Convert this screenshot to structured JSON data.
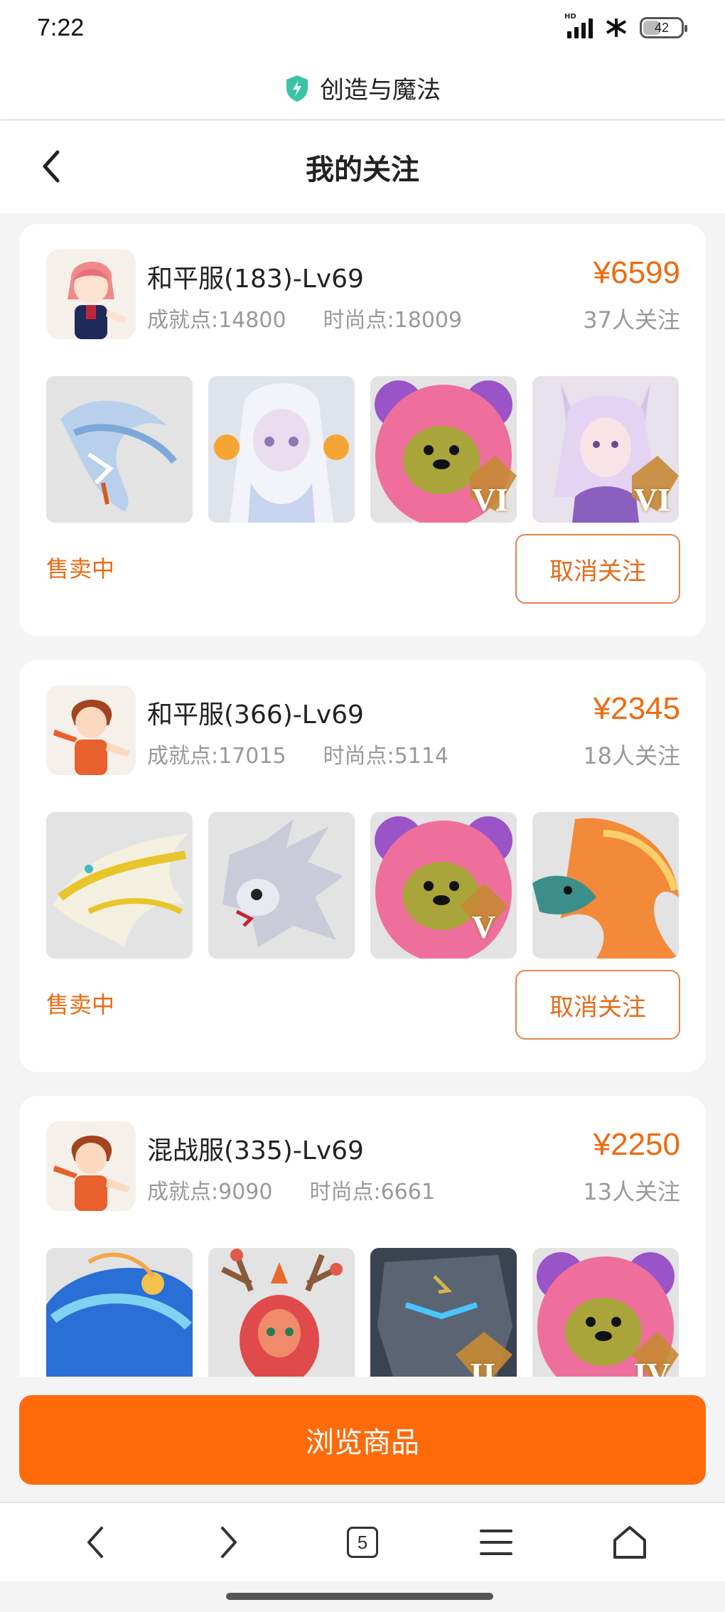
{
  "status_bar": {
    "time": "7:22",
    "battery": "42",
    "network_label": "HD"
  },
  "app": {
    "title": "创造与魔法",
    "icon": "shield-bolt-icon"
  },
  "header": {
    "title": "我的关注",
    "back_icon": "chevron-left-icon"
  },
  "listings": [
    {
      "server": "和平服(183)-Lv69",
      "achievement": "成就点:14800",
      "fashion": "时尚点:18009",
      "price": "¥6599",
      "followers": "37人关注",
      "status": "售卖中",
      "unfollow_label": "取消关注",
      "avatar": "pink-hair-character-avatar",
      "items": [
        {
          "name": "ice-dragon-mount",
          "badge": ""
        },
        {
          "name": "white-hair-spirit",
          "badge": ""
        },
        {
          "name": "pink-bear-outfit",
          "badge": "VI"
        },
        {
          "name": "fox-spirit-girl",
          "badge": "VI"
        }
      ]
    },
    {
      "server": "和平服(366)-Lv69",
      "achievement": "成就点:17015",
      "fashion": "时尚点:5114",
      "price": "¥2345",
      "followers": "18人关注",
      "status": "售卖中",
      "unfollow_label": "取消关注",
      "avatar": "red-hair-boy-avatar",
      "items": [
        {
          "name": "golden-dragon-mount",
          "badge": ""
        },
        {
          "name": "silver-dragon-pet",
          "badge": ""
        },
        {
          "name": "pink-bear-outfit",
          "badge": "V"
        },
        {
          "name": "fire-qilin-mount",
          "badge": ""
        }
      ]
    },
    {
      "server": "混战服(335)-Lv69",
      "achievement": "成就点:9090",
      "fashion": "时尚点:6661",
      "price": "¥2250",
      "followers": "13人关注",
      "status": "",
      "unfollow_label": "",
      "avatar": "red-hair-boy-avatar",
      "items": [
        {
          "name": "blue-whale-mount",
          "badge": ""
        },
        {
          "name": "red-deer-dragon",
          "badge": ""
        },
        {
          "name": "stone-golem",
          "badge": "II"
        },
        {
          "name": "pink-bear-outfit",
          "badge": "IV"
        }
      ]
    }
  ],
  "browse_button": {
    "label": "浏览商品"
  },
  "browser_nav": {
    "tabs_count": "5"
  },
  "colors": {
    "accent": "#ff6a0b",
    "price": "#ee6a0f",
    "muted": "#999999"
  }
}
